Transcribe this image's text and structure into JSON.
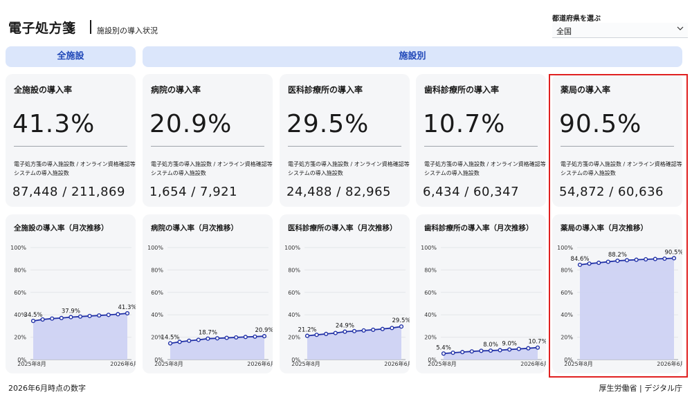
{
  "header": {
    "title": "電子処方箋",
    "subtitle": "施設別の導入状況",
    "prefecture_label": "都道府県を選ぶ",
    "prefecture_value": "全国"
  },
  "bands": {
    "all": "全施設",
    "by_facility": "施設別"
  },
  "kpis": [
    {
      "title": "全施設の導入率",
      "value": "41.3%",
      "desc": "電子処方箋の導入施設数 / オンライン資格確認等システムの導入施設数",
      "count": "87,448 / 211,869"
    },
    {
      "title": "病院の導入率",
      "value": "20.9%",
      "desc": "電子処方箋の導入施設数 / オンライン資格確認等システムの導入施設数",
      "count": "1,654 / 7,921"
    },
    {
      "title": "医科診療所の導入率",
      "value": "29.5%",
      "desc": "電子処方箋の導入施設数 / オンライン資格確認等システムの導入施設数",
      "count": "24,488 / 82,965"
    },
    {
      "title": "歯科診療所の導入率",
      "value": "10.7%",
      "desc": "電子処方箋の導入施設数 / オンライン資格確認等システムの導入施設数",
      "count": "6,434 / 60,347"
    },
    {
      "title": "薬局の導入率",
      "value": "90.5%",
      "desc": "電子処方箋の導入施設数 / オンライン資格確認等システムの導入施設数",
      "count": "54,872 / 60,636"
    }
  ],
  "chart_data": [
    {
      "type": "area",
      "title": "全施設の導入率（月次推移）",
      "x_start": "2025年8月",
      "x_end": "2026年6月",
      "yticks": [
        "100%",
        "80%",
        "60%",
        "40%",
        "20%",
        "0%"
      ],
      "ylim": [
        0,
        100
      ],
      "values": [
        34.5,
        35.8,
        36.6,
        37.1,
        37.9,
        38.4,
        38.9,
        39.4,
        39.9,
        40.5,
        41.3
      ],
      "labels": [
        {
          "i": 0,
          "text": "34.5%"
        },
        {
          "i": 4,
          "text": "37.9%"
        },
        {
          "i": 10,
          "text": "41.3%"
        }
      ]
    },
    {
      "type": "area",
      "title": "病院の導入率（月次推移）",
      "x_start": "2025年8月",
      "x_end": "2026年6月",
      "yticks": [
        "100%",
        "80%",
        "60%",
        "40%",
        "20%",
        "0%"
      ],
      "ylim": [
        0,
        100
      ],
      "values": [
        14.5,
        15.8,
        16.8,
        17.6,
        18.7,
        19.0,
        19.4,
        19.8,
        20.2,
        20.5,
        20.9
      ],
      "labels": [
        {
          "i": 0,
          "text": "14.5%"
        },
        {
          "i": 4,
          "text": "18.7%"
        },
        {
          "i": 10,
          "text": "20.9%"
        }
      ]
    },
    {
      "type": "area",
      "title": "医科診療所の導入率（月次推移）",
      "x_start": "2025年8月",
      "x_end": "2026年6月",
      "yticks": [
        "100%",
        "80%",
        "60%",
        "40%",
        "20%",
        "0%"
      ],
      "ylim": [
        0,
        100
      ],
      "values": [
        21.2,
        22.1,
        22.9,
        23.7,
        24.9,
        25.4,
        26.0,
        26.6,
        27.3,
        28.2,
        29.5
      ],
      "labels": [
        {
          "i": 0,
          "text": "21.2%"
        },
        {
          "i": 4,
          "text": "24.9%"
        },
        {
          "i": 10,
          "text": "29.5%"
        }
      ]
    },
    {
      "type": "area",
      "title": "歯科診療所の導入率（月次推移）",
      "x_start": "2025年8月",
      "x_end": "2026年6月",
      "yticks": [
        "100%",
        "80%",
        "60%",
        "40%",
        "20%",
        "0%"
      ],
      "ylim": [
        0,
        100
      ],
      "values": [
        5.4,
        6.1,
        6.7,
        7.3,
        7.8,
        8.0,
        8.4,
        9.0,
        9.5,
        10.1,
        10.7
      ],
      "labels": [
        {
          "i": 0,
          "text": "5.4%"
        },
        {
          "i": 5,
          "text": "8.0%"
        },
        {
          "i": 7,
          "text": "9.0%"
        },
        {
          "i": 10,
          "text": "10.7%"
        }
      ]
    },
    {
      "type": "area",
      "title": "薬局の導入率（月次推移）",
      "x_start": "2025年8月",
      "x_end": "2026年6月",
      "yticks": [
        "100%",
        "80%",
        "60%",
        "40%",
        "20%",
        "0%"
      ],
      "ylim": [
        0,
        100
      ],
      "values": [
        84.6,
        85.7,
        86.4,
        87.3,
        88.2,
        88.7,
        89.1,
        89.5,
        89.8,
        90.1,
        90.5
      ],
      "labels": [
        {
          "i": 0,
          "text": "84.6%"
        },
        {
          "i": 4,
          "text": "88.2%"
        },
        {
          "i": 10,
          "text": "90.5%"
        }
      ]
    }
  ],
  "colors": {
    "line": "#1f2fa6",
    "area": "#ccd0f3",
    "band_bg": "#dbe6fb",
    "band_text": "#1f47b8",
    "highlight": "#e02020"
  },
  "footer": {
    "left": "2026年6月時点の数字",
    "right": "厚生労働省 | デジタル庁"
  }
}
